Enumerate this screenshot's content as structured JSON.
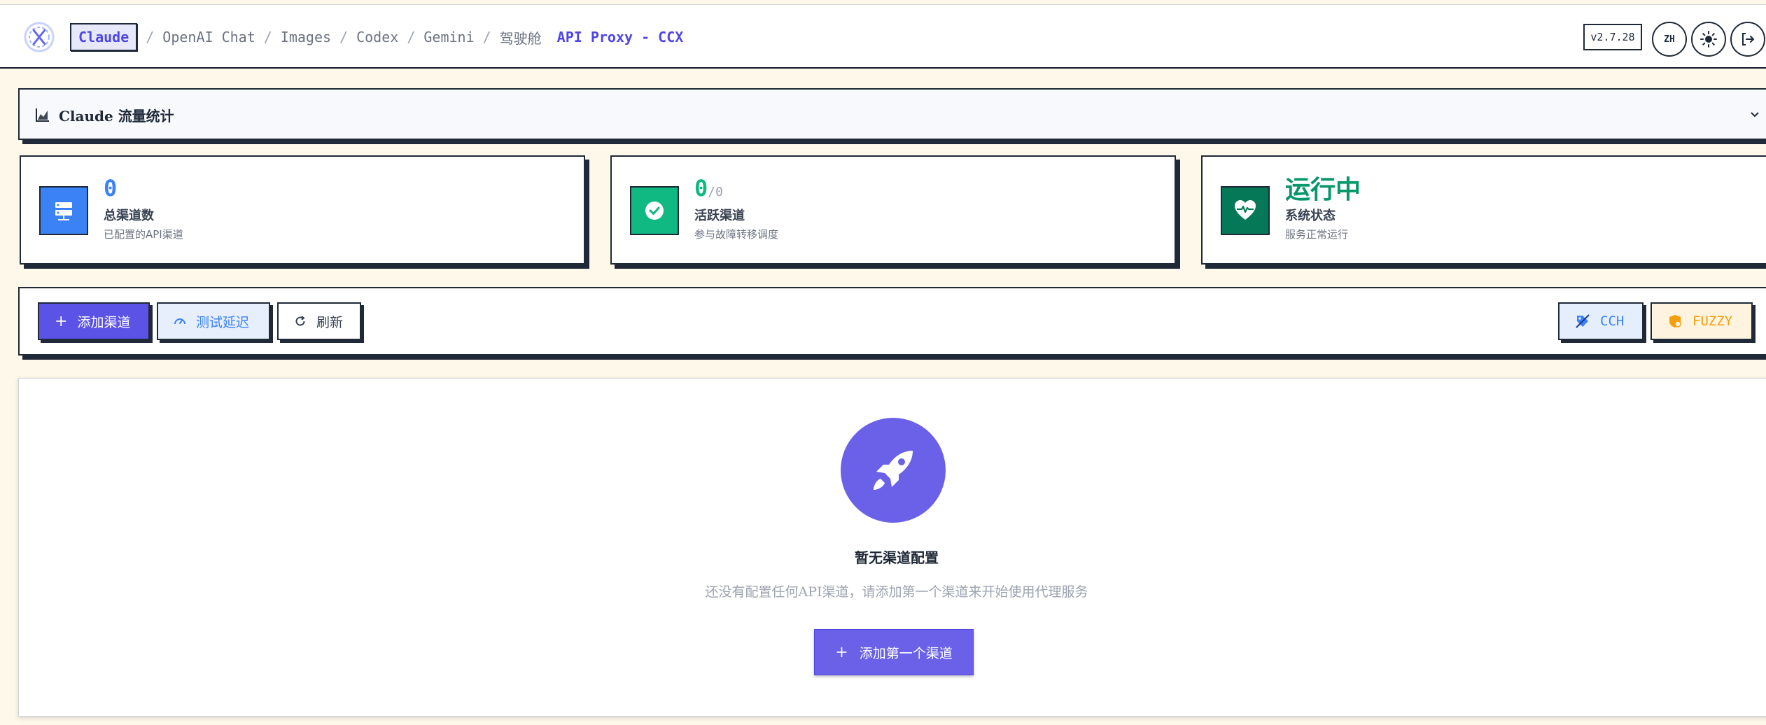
{
  "nav": {
    "crumbs": [
      "Claude",
      "OpenAI Chat",
      "Images",
      "Codex",
      "Gemini",
      "驾驶舱"
    ],
    "title": "API Proxy - CCX",
    "version": "v2.7.28",
    "lang_label": "ZH"
  },
  "traffic": {
    "label": "Claude 流量统计"
  },
  "cards": [
    {
      "value": "0",
      "sub": "",
      "label": "总渠道数",
      "desc": "已配置的API渠道",
      "color": "#3b82f6",
      "icon": "server-icon"
    },
    {
      "value": "0",
      "sub": "/0",
      "label": "活跃渠道",
      "desc": "参与故障转移调度",
      "color": "#10b981",
      "icon": "check-circle-icon"
    },
    {
      "value": "运行中",
      "sub": "",
      "label": "系统状态",
      "desc": "服务正常运行",
      "color": "#059669",
      "icon": "heart-pulse-icon"
    }
  ],
  "toolbar": {
    "add_label": "添加渠道",
    "ping_label": "测试延迟",
    "refresh_label": "刷新",
    "cch_label": "CCH",
    "fuzzy_label": "FUZZY"
  },
  "empty": {
    "title": "暂无渠道配置",
    "desc": "还没有配置任何API渠道，请添加第一个渠道来开始使用代理服务",
    "button_label": "添加第一个渠道"
  },
  "colors": {
    "primary": "#5b53e6",
    "accent_blue": "#3b82f6",
    "accent_green": "#10b981",
    "accent_orange": "#f59e0b"
  }
}
